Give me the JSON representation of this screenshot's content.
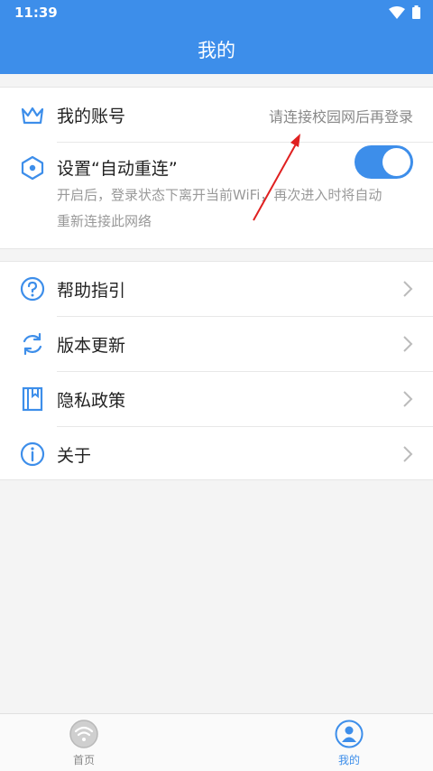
{
  "status": {
    "time": "11:39"
  },
  "header": {
    "title": "我的"
  },
  "account": {
    "label": "我的账号",
    "value": "请连接校园网后再登录"
  },
  "reconnect": {
    "label": "设置“自动重连”",
    "enabled": true,
    "desc_line1": "开启后，登录状态下离开当前WiFi，再次进入时将自动",
    "desc_line2": "重新连接此网络"
  },
  "menu": [
    {
      "label": "帮助指引",
      "icon": "question-icon"
    },
    {
      "label": "版本更新",
      "icon": "refresh-icon"
    },
    {
      "label": "隐私政策",
      "icon": "book-icon"
    },
    {
      "label": "关于",
      "icon": "info-icon"
    }
  ],
  "tabs": [
    {
      "label": "首页",
      "icon": "wifi-icon",
      "active": false
    },
    {
      "label": "我的",
      "icon": "user-icon",
      "active": true
    }
  ],
  "colors": {
    "accent": "#3d8eea",
    "inactive": "#888888",
    "annotation": "#e02020"
  }
}
